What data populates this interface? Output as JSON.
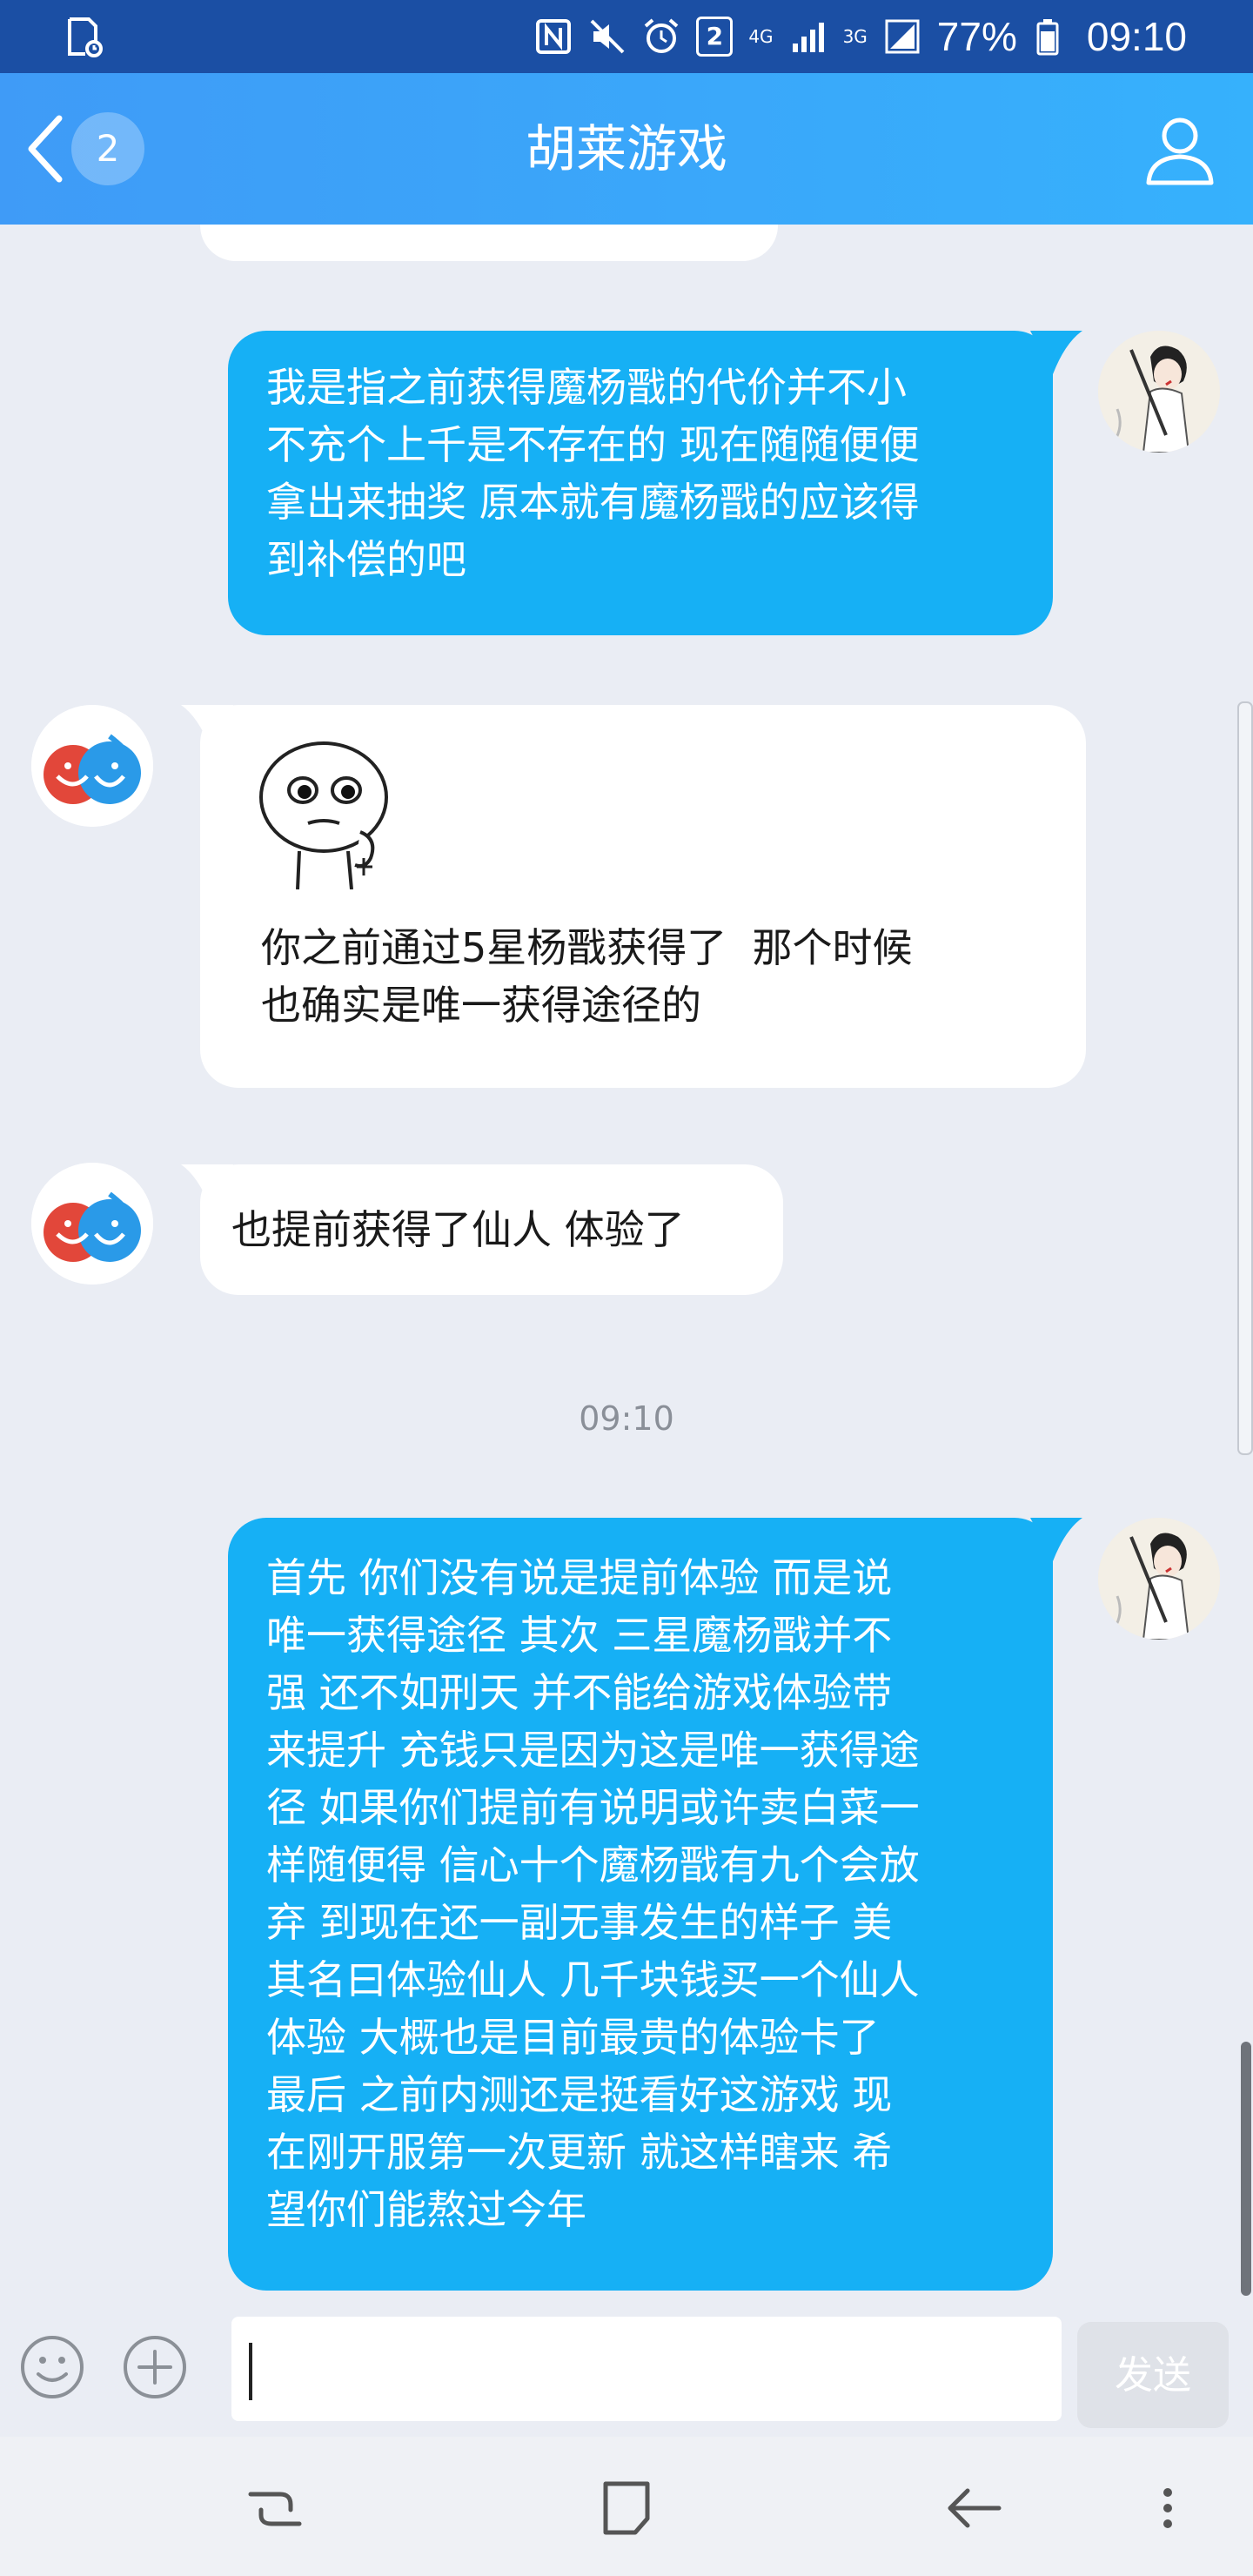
{
  "status_bar": {
    "sim_badge": "2",
    "network_4g": "4G",
    "network_3g": "3G",
    "battery": "77%",
    "time": "09:10",
    "icons": [
      "sim-card-icon",
      "nfc-icon",
      "mute-icon",
      "alarm-icon",
      "signal-icon",
      "battery-icon"
    ]
  },
  "header": {
    "back_badge": "2",
    "title": "胡莱游戏"
  },
  "messages": [
    {
      "side": "out",
      "text": "我是指之前获得魔杨戬的代价并不小\n不充个上千是不存在的 现在随随便便\n拿出来抽奖 原本就有魔杨戬的应该得\n到补偿的吧"
    },
    {
      "side": "in",
      "sticker": "meme-sticker",
      "text": "你之前通过5星杨戬获得了  那个时候\n也确实是唯一获得途径的"
    },
    {
      "side": "in",
      "text": "也提前获得了仙人 体验了"
    },
    {
      "side": "out",
      "text": "首先 你们没有说是提前体验 而是说\n唯一获得途径 其次 三星魔杨戬并不\n强 还不如刑天 并不能给游戏体验带\n来提升 充钱只是因为这是唯一获得途\n径 如果你们提前有说明或许卖白菜一\n样随便得 信心十个魔杨戬有九个会放\n弃 到现在还一副无事发生的样子 美\n其名曰体验仙人 几千块钱买一个仙人\n体验 大概也是目前最贵的体验卡了\n最后 之前内测还是挺看好这游戏 现\n在刚开服第一次更新 就这样瞎来 希\n望你们能熬过今年"
    }
  ],
  "timestamp": "09:10",
  "input_bar": {
    "placeholder": "",
    "send_label": "发送"
  },
  "colors": {
    "header": "#36b1fc",
    "outgoing_bubble": "#16b0f5",
    "incoming_bubble": "#ffffff",
    "background": "#eaedf4"
  }
}
